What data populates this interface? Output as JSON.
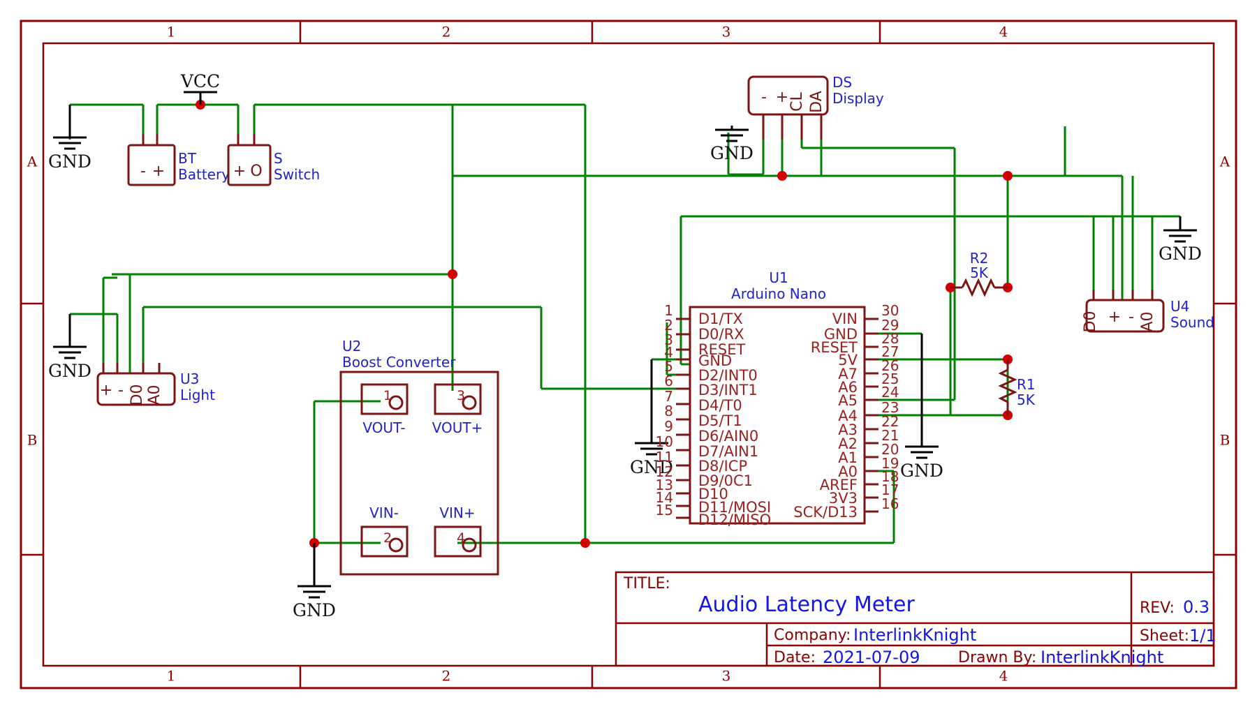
{
  "sheet": {
    "title_label": "TITLE:",
    "title": "Audio Latency Meter",
    "rev_label": "REV:",
    "rev": "0.3",
    "company_label": "Company:",
    "company": "InterlinkKnight",
    "sheet_label": "Sheet:",
    "sheet_number": "1/1",
    "date_label": "Date:",
    "date": "2021-07-09",
    "drawn_label": "Drawn By:",
    "drawn_by": "InterlinkKnight",
    "zones_top": [
      "1",
      "2",
      "3",
      "4"
    ],
    "zones_bottom": [
      "1",
      "2",
      "3",
      "4"
    ],
    "zones_left": [
      "A",
      "B"
    ],
    "zones_right": [
      "A",
      "B"
    ],
    "colors": {
      "wire": "#008000",
      "symbol": "#7d1414",
      "frame": "#8b0000",
      "reference": "#2222cc",
      "value": "#1414ee",
      "junction": "#d40000"
    }
  },
  "nets": {
    "vcc_label": "VCC",
    "gnd_label": "GND",
    "gnd_count": 7
  },
  "components": [
    {
      "id": "BT",
      "ref": "BT",
      "name": "Battery",
      "pins": [
        "-",
        "+"
      ]
    },
    {
      "id": "S",
      "ref": "S",
      "name": "Switch",
      "pins": [
        "+",
        "O"
      ]
    },
    {
      "id": "DS",
      "ref": "DS",
      "name": "Display",
      "pins": [
        "-",
        "+",
        "CL",
        "DA"
      ]
    },
    {
      "id": "U1",
      "ref": "U1",
      "name": "Arduino Nano",
      "left_pins": [
        {
          "num": "1",
          "name": "D1/TX"
        },
        {
          "num": "2",
          "name": "D0/RX"
        },
        {
          "num": "3",
          "name": "RESET"
        },
        {
          "num": "4",
          "name": "GND"
        },
        {
          "num": "5",
          "name": "D2/INT0"
        },
        {
          "num": "6",
          "name": "D3/INT1"
        },
        {
          "num": "7",
          "name": "D4/T0"
        },
        {
          "num": "8",
          "name": "D5/T1"
        },
        {
          "num": "9",
          "name": "D6/AIN0"
        },
        {
          "num": "10",
          "name": "D7/AIN1"
        },
        {
          "num": "11",
          "name": "D8/ICP"
        },
        {
          "num": "12",
          "name": "D9/0C1"
        },
        {
          "num": "13",
          "name": "D10"
        },
        {
          "num": "14",
          "name": "D11/MOSI"
        },
        {
          "num": "15",
          "name": "D12/MISO"
        }
      ],
      "right_pins": [
        {
          "num": "30",
          "name": "VIN"
        },
        {
          "num": "29",
          "name": "GND"
        },
        {
          "num": "28",
          "name": "RESET"
        },
        {
          "num": "27",
          "name": "5V"
        },
        {
          "num": "26",
          "name": "A7"
        },
        {
          "num": "25",
          "name": "A6"
        },
        {
          "num": "24",
          "name": "A5"
        },
        {
          "num": "23",
          "name": "A4"
        },
        {
          "num": "22",
          "name": "A3"
        },
        {
          "num": "21",
          "name": "A2"
        },
        {
          "num": "20",
          "name": "A1"
        },
        {
          "num": "19",
          "name": "A0"
        },
        {
          "num": "18",
          "name": "AREF"
        },
        {
          "num": "17",
          "name": "3V3"
        },
        {
          "num": "16",
          "name": "SCK/D13"
        }
      ]
    },
    {
      "id": "U2",
      "ref": "U2",
      "name": "Boost Converter",
      "pads": [
        {
          "num": "1",
          "label": "VOUT-"
        },
        {
          "num": "3",
          "label": "VOUT+"
        },
        {
          "num": "2",
          "label": "VIN-"
        },
        {
          "num": "4",
          "label": "VIN+"
        }
      ]
    },
    {
      "id": "U3",
      "ref": "U3",
      "name": "Light",
      "pins": [
        "+",
        "-",
        "D0",
        "A0"
      ]
    },
    {
      "id": "U4",
      "ref": "U4",
      "name": "Sound",
      "pins": [
        "D0",
        "+",
        "-",
        "A0"
      ]
    },
    {
      "id": "R1",
      "ref": "R1",
      "value": "5K",
      "orientation": "vertical"
    },
    {
      "id": "R2",
      "ref": "R2",
      "value": "5K",
      "orientation": "horizontal"
    }
  ]
}
